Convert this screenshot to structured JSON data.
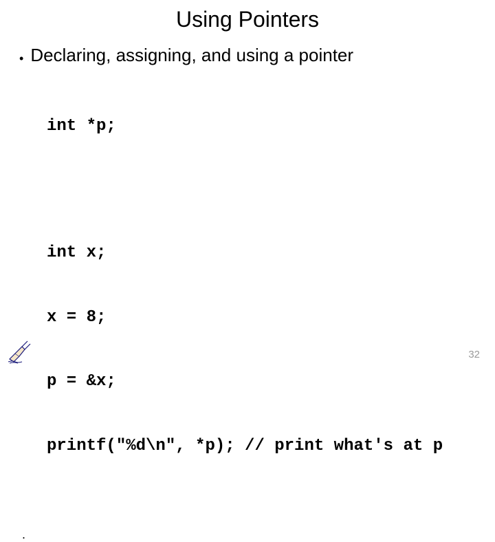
{
  "title": "Using Pointers",
  "bullet": {
    "text": "Declaring, assigning, and using a pointer"
  },
  "code": {
    "l1": "int *p;",
    "l2": "int x;",
    "l3": "x = 8;",
    "l4": "p = &x;",
    "l5": "printf(\"%d\\n\", *p); // print what's at p"
  },
  "lone_dot": ".",
  "page_number": "32"
}
